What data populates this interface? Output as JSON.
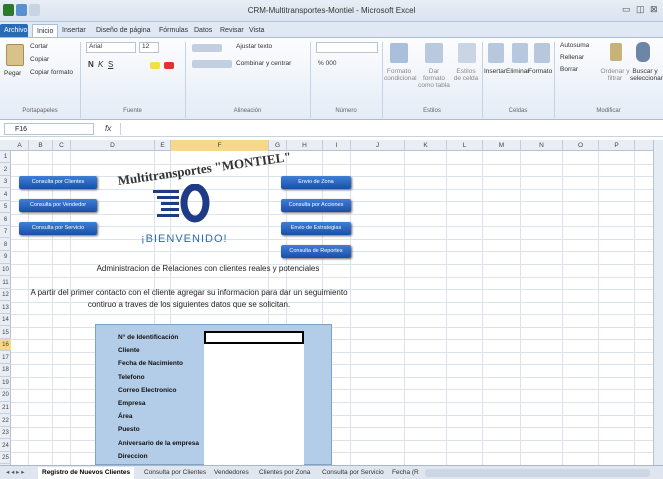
{
  "window": {
    "title": "CRM-Multitransportes-Montiel - Microsoft Excel",
    "min": "▭",
    "restore": "◫",
    "close": "⊠"
  },
  "tabs": [
    "Archivo",
    "Inicio",
    "Insertar",
    "Diseño de página",
    "Fórmulas",
    "Datos",
    "Revisar",
    "Vista"
  ],
  "ribbon": {
    "paste": "Pegar",
    "cut": "Cortar",
    "copy": "Copiar",
    "format_painter": "Copiar formato",
    "font_name": "Arial",
    "font_size": "12",
    "wrap": "Ajustar texto",
    "merge": "Combinar y centrar",
    "number_format": "",
    "percent": "% 000",
    "cond_format": "Formato condicional",
    "table_format": "Dar formato como tabla",
    "cell_styles": "Estilos de celda",
    "insert": "Insertar",
    "delete": "Eliminar",
    "format": "Formato",
    "autosum": "Autosuma",
    "fill": "Rellenar",
    "clear": "Borrar",
    "sort": "Ordenar y filtrar",
    "find": "Buscar y seleccionar",
    "groups": [
      "Portapapeles",
      "Fuente",
      "Alineación",
      "Número",
      "Estilos",
      "Celdas",
      "Modificar"
    ]
  },
  "formula_bar": {
    "name_box": "F16",
    "fx": "fx",
    "content": ""
  },
  "columns": [
    "A",
    "B",
    "C",
    "D",
    "E",
    "F",
    "G",
    "H",
    "I",
    "J",
    "K",
    "L",
    "M",
    "N",
    "O",
    "P"
  ],
  "rows": [
    "1",
    "2",
    "3",
    "4",
    "5",
    "6",
    "7",
    "8",
    "9",
    "10",
    "11",
    "12",
    "13",
    "14",
    "15",
    "16",
    "17",
    "18",
    "19",
    "20",
    "21",
    "22",
    "23",
    "24",
    "25"
  ],
  "buttons_left": [
    "Consulta por Clientes",
    "Consulta por Vendedor",
    "Consulta por Servicio"
  ],
  "buttons_right": [
    "Envio de Zona",
    "Consulta por Acciones",
    "Envio de Estrategias",
    "Consulta de Reportes"
  ],
  "logo": "Multitransportes \"MONTIEL\"",
  "welcome": "¡BIENVENIDO!",
  "subtitle": "Administracion de Relaciones con clientes reales y potenciales",
  "intro1": "A partir del primer contacto con el cliente agregar su informacion para dar un seguimiento",
  "intro2": "contiruo a traves de los siguientes datos que se solicitan.",
  "form_labels": [
    "N° de Identificación",
    "Cliente",
    "Fecha de Nacimiento",
    "Telefono",
    "Correo Electronico",
    "Empresa",
    "Área",
    "Puesto",
    "Aniversario de la empresa",
    "Direccion"
  ],
  "sheet_tabs": [
    "Registro de Nuevos Clientes",
    "Consulta por Clientes",
    "Vendedores",
    "Clientes por Zona",
    "Consulta por Servicio",
    "Fecha (R"
  ],
  "colors": {
    "accent": "#2a6bb8",
    "form_bg": "#b3cce8",
    "button": "#1a4fa8",
    "welcome": "#2f6bb0"
  }
}
